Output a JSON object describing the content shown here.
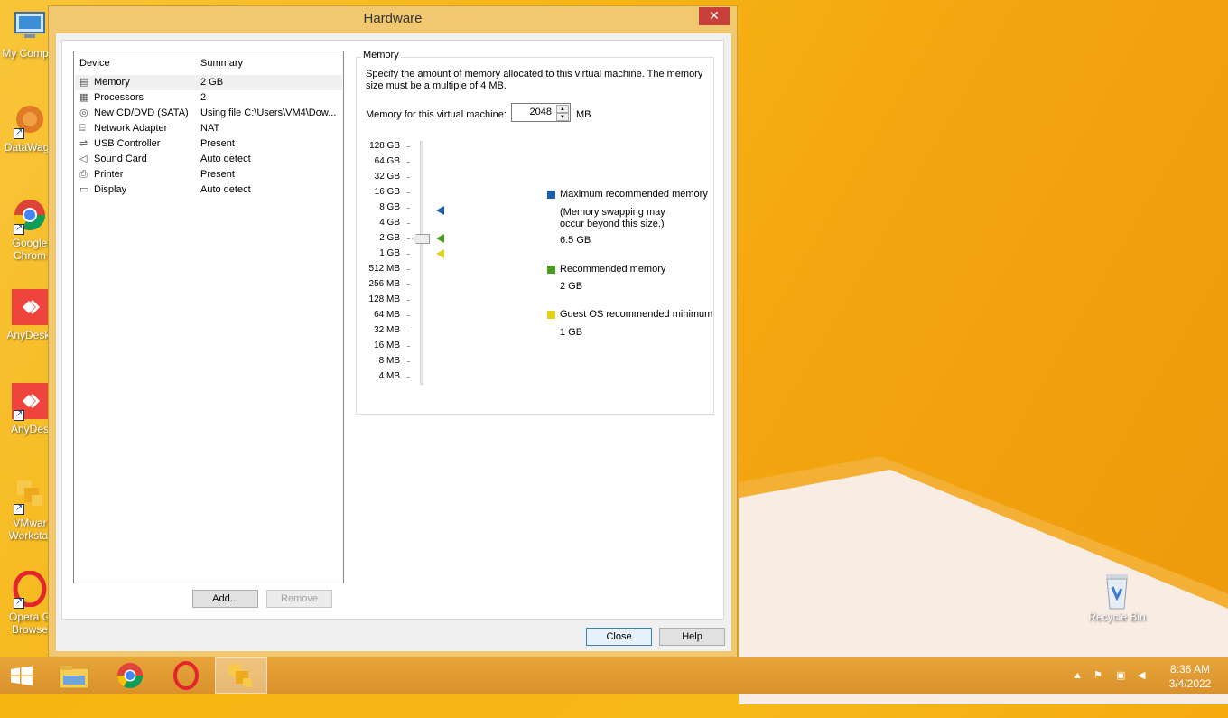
{
  "desktop": {
    "icons": [
      {
        "name": "mycomputer",
        "label": "My Comput"
      },
      {
        "name": "datawago",
        "label": "DataWago"
      },
      {
        "name": "chrome",
        "label": "Google Chrom"
      },
      {
        "name": "anydesk1",
        "label": "AnyDesk."
      },
      {
        "name": "anydesk2",
        "label": "AnyDes"
      },
      {
        "name": "vmware",
        "label": "VMwar Workstat"
      },
      {
        "name": "opera",
        "label": "Opera G Browse"
      }
    ],
    "recycle_bin": "Recycle Bin"
  },
  "dialog": {
    "title": "Hardware",
    "close_glyph": "✕",
    "device_list": {
      "headers": {
        "device": "Device",
        "summary": "Summary"
      },
      "rows": [
        {
          "icon": "memory-icon",
          "glyph": "▤",
          "device": "Memory",
          "summary": "2 GB"
        },
        {
          "icon": "processor-icon",
          "glyph": "▦",
          "device": "Processors",
          "summary": "2"
        },
        {
          "icon": "cd-dvd-icon",
          "glyph": "◎",
          "device": "New CD/DVD (SATA)",
          "summary": "Using file C:\\Users\\VM4\\Dow..."
        },
        {
          "icon": "network-icon",
          "glyph": "⌸",
          "device": "Network Adapter",
          "summary": "NAT"
        },
        {
          "icon": "usb-icon",
          "glyph": "⇌",
          "device": "USB Controller",
          "summary": "Present"
        },
        {
          "icon": "sound-icon",
          "glyph": "◁",
          "device": "Sound Card",
          "summary": "Auto detect"
        },
        {
          "icon": "printer-icon",
          "glyph": "⎙",
          "device": "Printer",
          "summary": "Present"
        },
        {
          "icon": "display-icon",
          "glyph": "▭",
          "device": "Display",
          "summary": "Auto detect"
        }
      ]
    },
    "add_button": "Add...",
    "remove_button": "Remove",
    "memory": {
      "legend": "Memory",
      "description": "Specify the amount of memory allocated to this virtual machine. The memory size must be a multiple of 4 MB.",
      "input_label": "Memory for this virtual machine:",
      "value": "2048",
      "unit": "MB",
      "scale": [
        "128 GB",
        "64 GB",
        "32 GB",
        "16 GB",
        "8 GB",
        "4 GB",
        "2 GB",
        "1 GB",
        "512 MB",
        "256 MB",
        "128 MB",
        "64 MB",
        "32 MB",
        "16 MB",
        "8 MB",
        "4 MB"
      ],
      "selected_index": 6,
      "markers": [
        {
          "name": "max-recommended",
          "index": 4.2,
          "color": "#1a5fa8"
        },
        {
          "name": "recommended",
          "index": 6,
          "color": "#4b9a22"
        },
        {
          "name": "guest-minimum",
          "index": 7,
          "color": "#e0d21a"
        }
      ],
      "legend_items": {
        "max_title": "Maximum recommended memory",
        "max_note": "(Memory swapping may occur beyond this size.)",
        "max_value": "6.5 GB",
        "rec_title": "Recommended memory",
        "rec_value": "2 GB",
        "min_title": "Guest OS recommended minimum",
        "min_value": "1 GB"
      },
      "colors": {
        "max": "#1a5fa8",
        "recommended": "#4b9a22",
        "minimum": "#e0d21a"
      }
    },
    "close_button": "Close",
    "help_button": "Help"
  },
  "taskbar": {
    "time": "8:36 AM",
    "date": "3/4/2022"
  }
}
